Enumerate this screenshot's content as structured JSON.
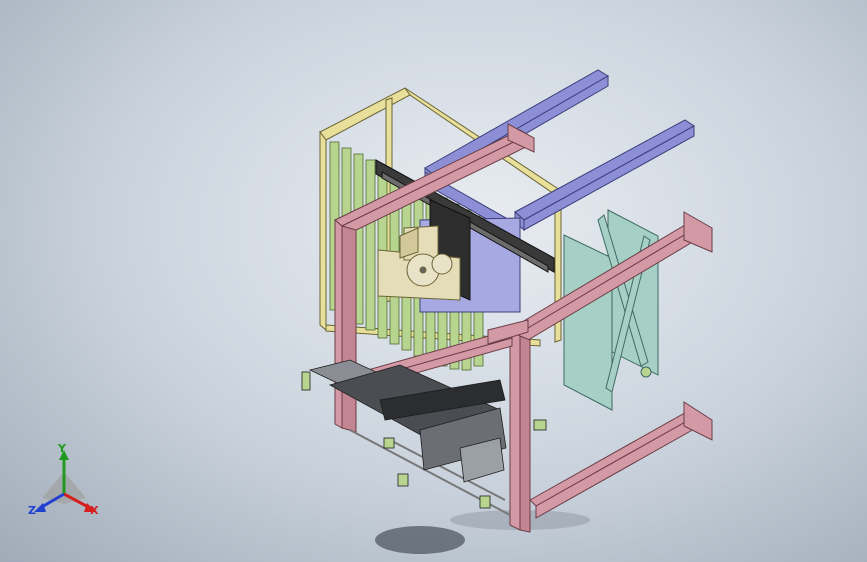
{
  "viewport": {
    "background_top": "#e9edf2",
    "background_bottom": "#9fabb8"
  },
  "model": {
    "frame_color": "#d39aa5",
    "beam_color": "#8c8fd6",
    "panel_color": "#a6cfc6",
    "rack_color": "#b8d58f",
    "rack_frame_color": "#e8df9a",
    "housing_color": "#e5dcb8"
  },
  "triad": {
    "x_label": "X",
    "y_label": "Y",
    "z_label": "Z",
    "x_color": "#d52020",
    "y_color": "#1e9a1e",
    "z_color": "#2240d0"
  }
}
